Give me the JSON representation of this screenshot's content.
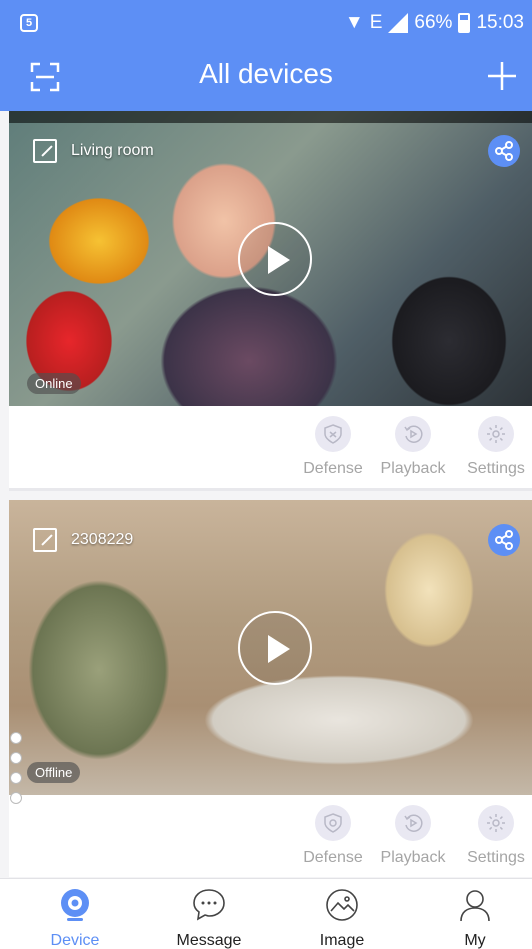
{
  "status_bar": {
    "battery_percent": "66%",
    "network_type": "E",
    "time": "15:03"
  },
  "header": {
    "title": "All devices"
  },
  "devices": [
    {
      "name": "Living room",
      "status": "Online",
      "actions": [
        "Defense",
        "Playback",
        "Settings"
      ]
    },
    {
      "name": "2308229",
      "status": "Offline",
      "actions": [
        "Defense",
        "Playback",
        "Settings"
      ]
    }
  ],
  "bottom_nav": {
    "items": [
      "Device",
      "Message",
      "Image",
      "My"
    ],
    "active": "Device"
  },
  "colors": {
    "accent": "#5d8ff5",
    "action_circle": "#e9e8f2",
    "action_label": "#a5a5a5"
  },
  "icons": {
    "scan": "scan-icon",
    "add": "plus-icon",
    "share": "share-icon",
    "play": "play-icon",
    "defense": "shield-icon",
    "playback": "playback-icon",
    "settings": "gear-icon"
  }
}
